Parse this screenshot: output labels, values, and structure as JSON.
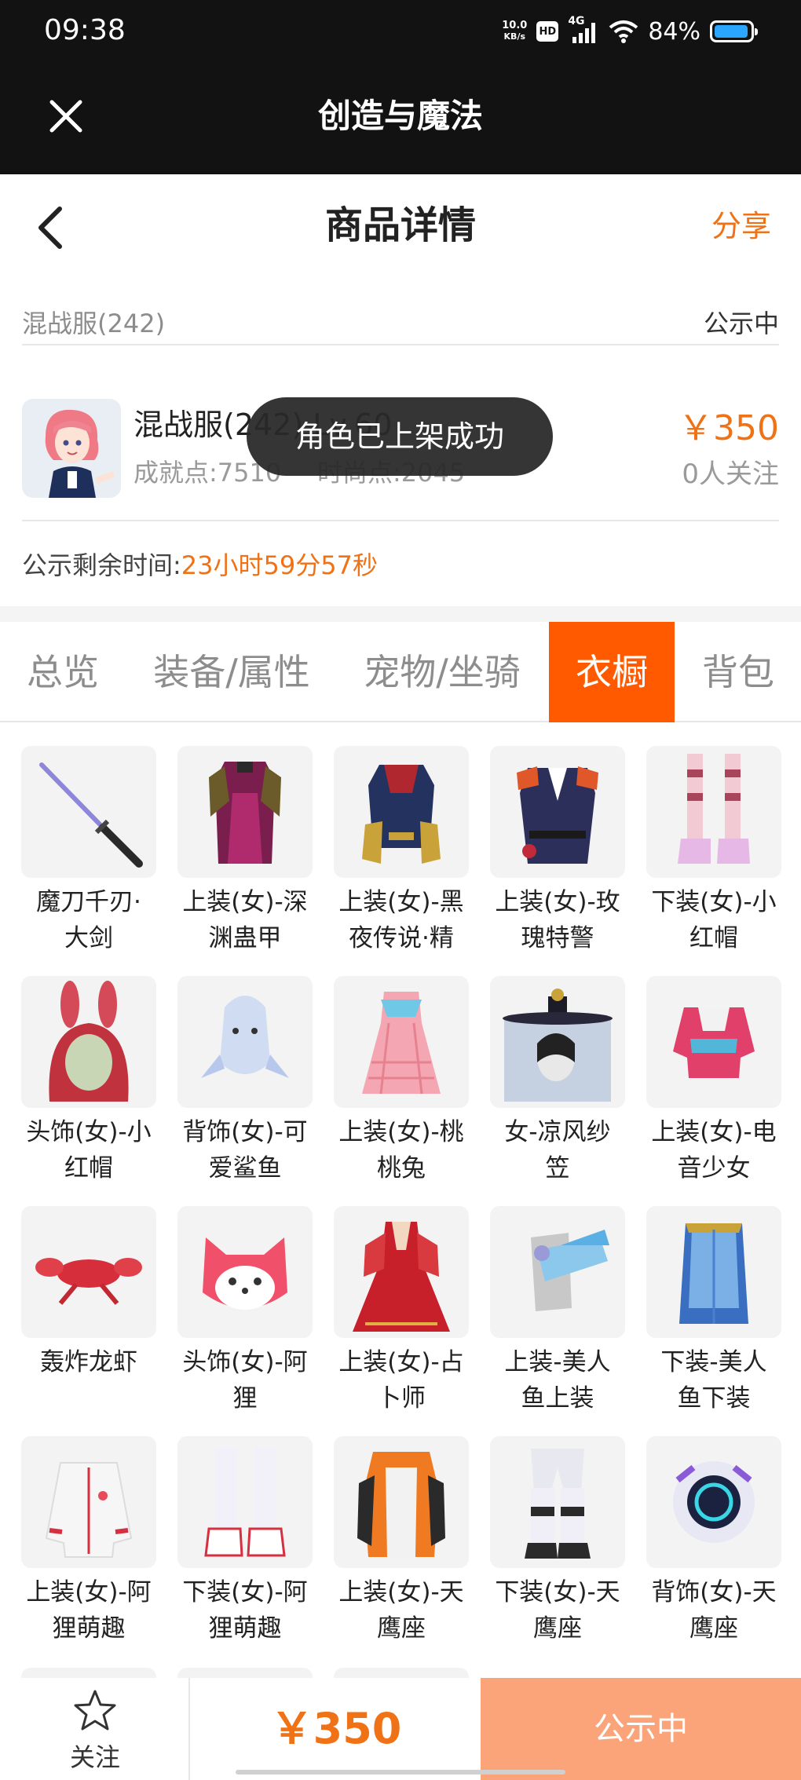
{
  "status_bar": {
    "time": "09:38",
    "net_speed_value": "10.0",
    "net_speed_unit": "KB/s",
    "hd": "HD",
    "signal": "4G",
    "battery": "84%"
  },
  "app_bar": {
    "title": "创造与魔法"
  },
  "header": {
    "title": "商品详情",
    "share": "分享"
  },
  "info": {
    "server_name": "混战服(242)",
    "status": "公示中",
    "product_name": "混战服(242) Lv.60",
    "achievement": "成就点:7510",
    "fashion": "时尚点:2045",
    "price": "￥350",
    "followers": "0人关注",
    "remaining_label": "公示剩余时间:",
    "remaining_value": "23小时59分57秒"
  },
  "toast": "角色已上架成功",
  "tabs": [
    {
      "label": "总览",
      "active": false
    },
    {
      "label": "装备/属性",
      "active": false
    },
    {
      "label": "宠物/坐骑",
      "active": false
    },
    {
      "label": "衣橱",
      "active": true
    },
    {
      "label": "背包",
      "active": false
    }
  ],
  "wardrobe": [
    {
      "l1": "魔刀千刃·",
      "l2": "大剑",
      "icon": "katana-sword"
    },
    {
      "l1": "上装(女)-深",
      "l2": "渊蛊甲",
      "icon": "dark-armor-outfit"
    },
    {
      "l1": "上装(女)-黑",
      "l2": "夜传说·精",
      "icon": "navy-gold-outfit"
    },
    {
      "l1": "上装(女)-玫",
      "l2": "瑰特警",
      "icon": "police-uniform"
    },
    {
      "l1": "下装(女)-小",
      "l2": "红帽",
      "icon": "striped-stockings"
    },
    {
      "l1": "头饰(女)-小",
      "l2": "红帽",
      "icon": "red-bunny-hood"
    },
    {
      "l1": "背饰(女)-可",
      "l2": "爱鲨鱼",
      "icon": "shark-backpack"
    },
    {
      "l1": "上装(女)-桃",
      "l2": "桃兔",
      "icon": "pink-plaid-dress"
    },
    {
      "l1": "女-凉风纱",
      "l2": "笠",
      "icon": "veiled-hat"
    },
    {
      "l1": "上装(女)-电",
      "l2": "音少女",
      "icon": "pink-crop-jacket"
    },
    {
      "l1": "轰炸龙虾",
      "l2": "",
      "icon": "lobster"
    },
    {
      "l1": "头饰(女)-阿",
      "l2": "狸",
      "icon": "fox-head"
    },
    {
      "l1": "上装(女)-占",
      "l2": "卜师",
      "icon": "red-gown"
    },
    {
      "l1": "上装-美人",
      "l2": "鱼上装",
      "icon": "mermaid-top"
    },
    {
      "l1": "下装-美人",
      "l2": "鱼下装",
      "icon": "mermaid-tail"
    },
    {
      "l1": "上装(女)-阿",
      "l2": "狸萌趣",
      "icon": "white-hoodie"
    },
    {
      "l1": "下装(女)-阿",
      "l2": "狸萌趣",
      "icon": "white-boots"
    },
    {
      "l1": "上装(女)-天",
      "l2": "鹰座",
      "icon": "orange-mecha-jacket"
    },
    {
      "l1": "下装(女)-天",
      "l2": "鹰座",
      "icon": "mecha-pants"
    },
    {
      "l1": "背饰(女)-天",
      "l2": "鹰座",
      "icon": "orb-device"
    }
  ],
  "bottom_bar": {
    "follow": "关注",
    "price": "￥350",
    "action": "公示中"
  },
  "colors": {
    "accent": "#f07217",
    "tab_active": "#ff5a00",
    "action_bg": "#fba47a"
  }
}
